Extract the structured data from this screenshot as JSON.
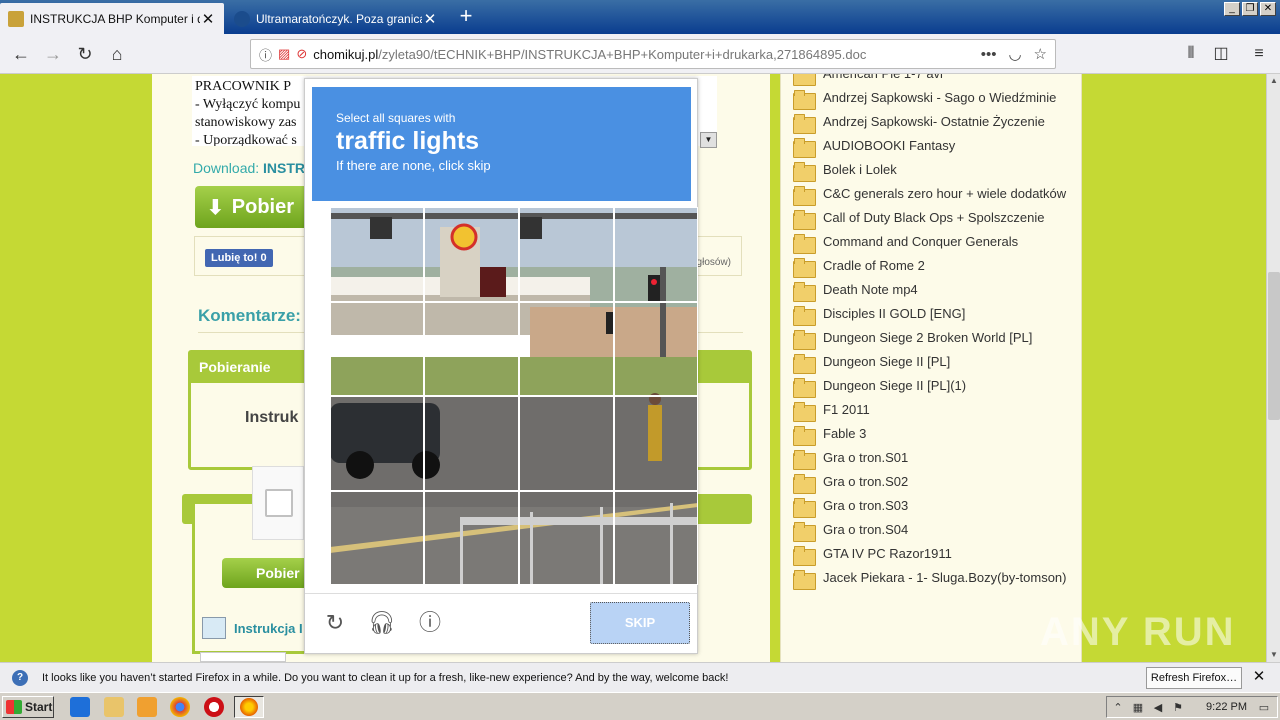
{
  "tabs": [
    {
      "title": "INSTRUKCJA BHP Komputer i druka",
      "close": "✕"
    },
    {
      "title": "Ultramaratończyk. Poza granicami",
      "close": "✕"
    }
  ],
  "newtab": "+",
  "nav": {
    "url_host": "chomikuj.pl",
    "url_path": "/zyleta90/tECHNIK+BHP/INSTRUKCJA+BHP+Komputer+i+drukarka,271864895.doc",
    "more": "•••"
  },
  "doc": {
    "lines": [
      "PRACOWNIK P",
      "- Wyłączyć kompu",
      "stanowiskowy zas",
      "- Uporządkować s"
    ],
    "download_label": "Download:",
    "download_name": "INSTRU",
    "pobierz_label": "Pobier",
    "like_label": "Lubię to! 0",
    "votes": "głosów)",
    "komentarze": "Komentarze:",
    "pobieranie": "Pobieranie",
    "instruk": "Instruk",
    "pobierz2_label": "Pobier",
    "instrukcja_file": "Instrukcja I"
  },
  "folders": [
    "American Pie 1-7 avi",
    "Andrzej Sapkowski - Sago o Wiedźminie",
    "Andrzej Sapkowski- Ostatnie Życzenie",
    "AUDIOBOOKI Fantasy",
    "Bolek i Lolek",
    "C&C generals zero hour + wiele dodatków",
    "Call of Duty Black Ops + Spolszczenie",
    "Command and Conquer Generals",
    "Cradle of Rome 2",
    "Death Note mp4",
    "Disciples II GOLD [ENG]",
    "Dungeon Siege 2 Broken World [PL]",
    "Dungeon Siege II [PL]",
    "Dungeon Siege II [PL](1)",
    "F1 2011",
    "Fable 3",
    "Gra o tron.S01",
    "Gra o tron.S02",
    "Gra o tron.S03",
    "Gra o tron.S04",
    "GTA IV PC Razor1911",
    "Jacek Piekara - 1- Sluga.Bozy(by-tomson)"
  ],
  "captcha": {
    "instruction": "Select all squares with",
    "target": "traffic lights",
    "hint": "If there are none, click skip",
    "skip_label": "SKIP",
    "rows": 4,
    "cols": 4
  },
  "notification": {
    "message": "It looks like you haven’t started Firefox in a while. Do you want to clean it up for a fresh, like-new experience? And by the way, welcome back!",
    "button": "Refresh Firefox…",
    "close": "✕"
  },
  "taskbar": {
    "start": "Start",
    "time": "9:22 PM"
  },
  "watermark": "ANY RUN",
  "colors": {
    "page_bg": "#c5d934",
    "captcha_header": "#4a90e2",
    "accent_green": "#a8c93a",
    "link_teal": "#2a8fa0"
  }
}
